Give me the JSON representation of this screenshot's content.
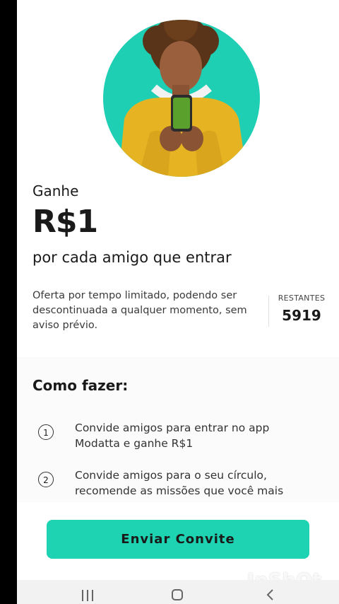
{
  "promo": {
    "ganhe": "Ganhe",
    "amount": "R$1",
    "per_friend": "por cada amigo que entrar",
    "offer_text": "Oferta por tempo limitado, podendo ser descontinuada a qualquer momento, sem aviso prévio.",
    "remaining_label": "RESTANTES",
    "remaining_value": "5919"
  },
  "how": {
    "title": "Como fazer:",
    "steps": [
      {
        "number": "1",
        "text": "Convide amigos para entrar no app Modatta e ganhe R$1"
      },
      {
        "number": "2",
        "text": "Convide amigos para o seu círculo, recomende as missões que você mais"
      }
    ]
  },
  "cta": {
    "label": "Enviar Convite"
  },
  "watermark": "InShOt",
  "icons": {
    "recents": "recents-icon",
    "home": "home-icon",
    "back": "back-icon"
  },
  "colors": {
    "accent": "#1dd3b1",
    "avatar_bg": "#1fcfb4",
    "sweater": "#e6b422"
  }
}
